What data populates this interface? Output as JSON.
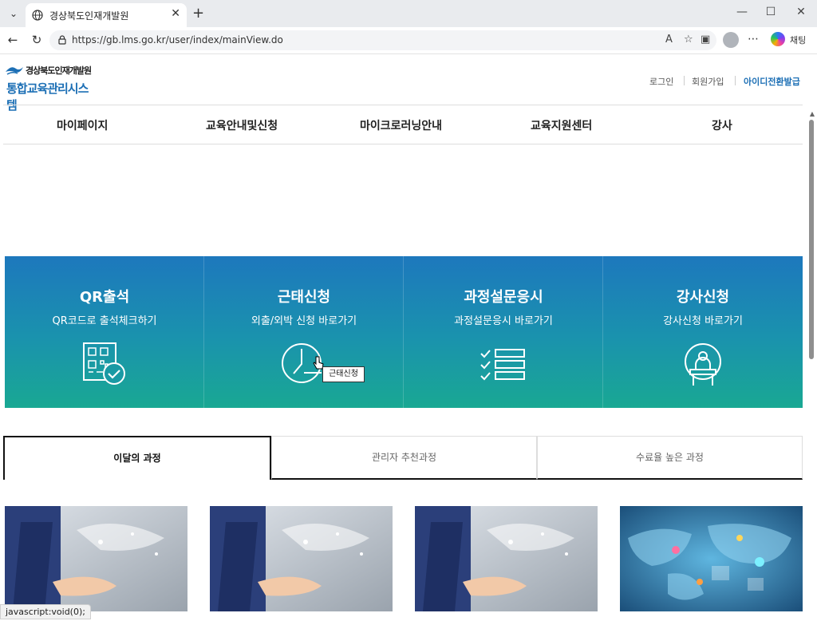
{
  "browser": {
    "tab_title": "경상북도인재개발원",
    "url": "https://gb.lms.go.kr/user/index/mainView.do",
    "chat_label": "채팅",
    "status_text": "javascript:void(0);"
  },
  "site": {
    "org_name": "경상북도인재개발원",
    "system_name": "통합교육관리시스템",
    "util_links": [
      "로그인",
      "회원가입",
      "아이디전환발급"
    ],
    "accent": "#1c6fb5"
  },
  "gnb": [
    "마이페이지",
    "교육안내및신청",
    "마이크로러닝안내",
    "교육지원센터",
    "강사"
  ],
  "quick_menu": [
    {
      "title": "QR출석",
      "subtitle": "QR코드로 출석체크하기",
      "icon": "qr-check-icon"
    },
    {
      "title": "근태신청",
      "subtitle": "외출/외박 신청 바로가기",
      "icon": "clock-icon"
    },
    {
      "title": "과정설문응시",
      "subtitle": "과정설문응시 바로가기",
      "icon": "checklist-icon"
    },
    {
      "title": "강사신청",
      "subtitle": "강사신청 바로가기",
      "icon": "lecturer-icon"
    }
  ],
  "tooltip": "근태신청",
  "course_tabs": [
    "이달의 과정",
    "관리자 추천과정",
    "수료율 높은 과정"
  ],
  "active_course_tab": 0
}
